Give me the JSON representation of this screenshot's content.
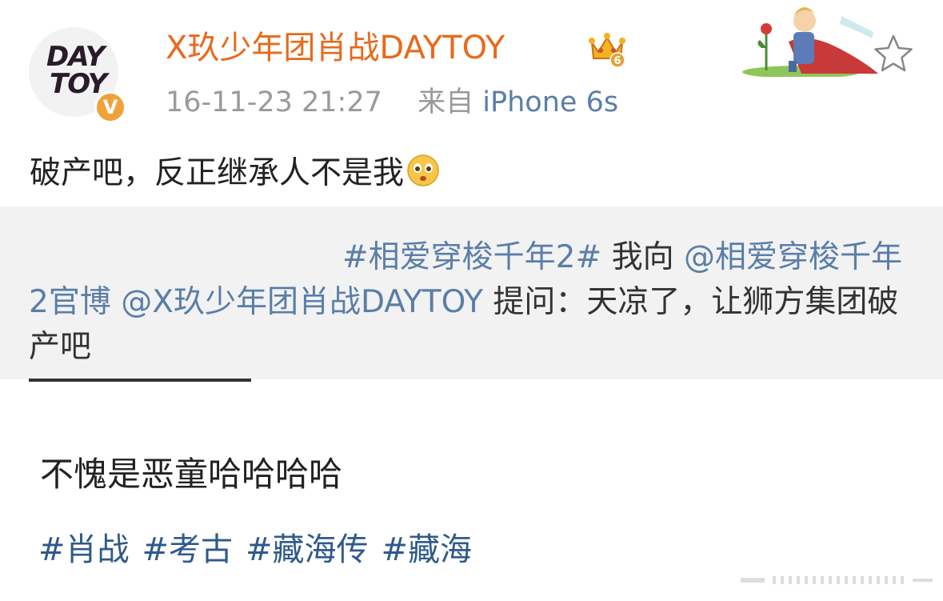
{
  "post": {
    "avatar_text_line1": "DAY",
    "avatar_text_line2": "TOY",
    "verified_badge": "V",
    "username": "X玖少年团肖战DAYTOY",
    "crown_level": "6",
    "timestamp": "16-11-23 21:27",
    "source_prefix": "来自",
    "source_device": "iPhone 6s",
    "text": "破产吧，反正继承人不是我",
    "emoji": "pleading-face-emoji"
  },
  "retweet": {
    "hashtag": "#相爱穿梭千年2#",
    "text_1": " 我向 ",
    "mention_1": "@相爱穿梭千年2官博",
    "space": " ",
    "mention_2": "@X玖少年团肖战DAYTOY",
    "text_2": " 提问：天凉了，让狮方集团破产吧"
  },
  "caption": {
    "comment": "不愧是恶童哈哈哈哈",
    "tags": [
      "#肖战",
      "#考古",
      "#藏海传",
      "#藏海"
    ]
  },
  "icons": {
    "favorite": "star-outline-icon",
    "decoration": "little-prince-sticker",
    "crown": "crown-badge-icon"
  },
  "colors": {
    "username": "#e86a1c",
    "link": "#5a7ea8",
    "tag": "#2f5a8a",
    "retweet_bg": "#f2f2f2",
    "badge": "#f0a13a"
  }
}
